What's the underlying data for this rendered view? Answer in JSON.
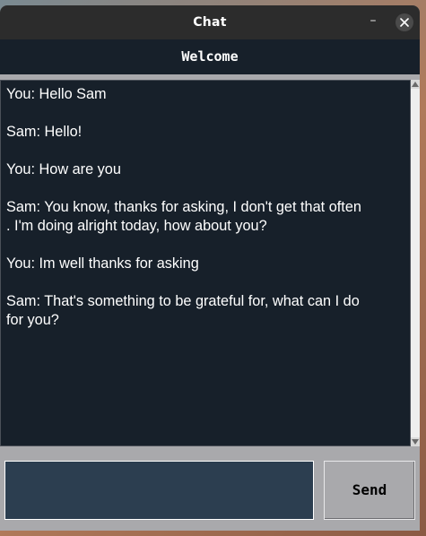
{
  "window": {
    "title": "Chat",
    "minimize_glyph": "–",
    "close_icon": "close-icon"
  },
  "header": {
    "label": "Welcome"
  },
  "messages": [
    {
      "lines": [
        "You: Hello Sam"
      ]
    },
    {
      "lines": [
        "Sam: Hello!"
      ]
    },
    {
      "lines": [
        "You: How are you"
      ]
    },
    {
      "lines": [
        "Sam: You know, thanks for asking, I don't get that often",
        ". I'm doing alright today, how about you?"
      ]
    },
    {
      "lines": [
        "You: Im well thanks for asking"
      ]
    },
    {
      "lines": [
        "Sam: That's something to be grateful for, what can I do",
        "for you?"
      ]
    }
  ],
  "input": {
    "value": "",
    "placeholder": ""
  },
  "send_button": {
    "label": "Send"
  },
  "colors": {
    "titlebar": "#2c2c2c",
    "chat_background": "#17202a",
    "input_background": "#2c3e50",
    "window_gray": "#a9a9ac"
  }
}
